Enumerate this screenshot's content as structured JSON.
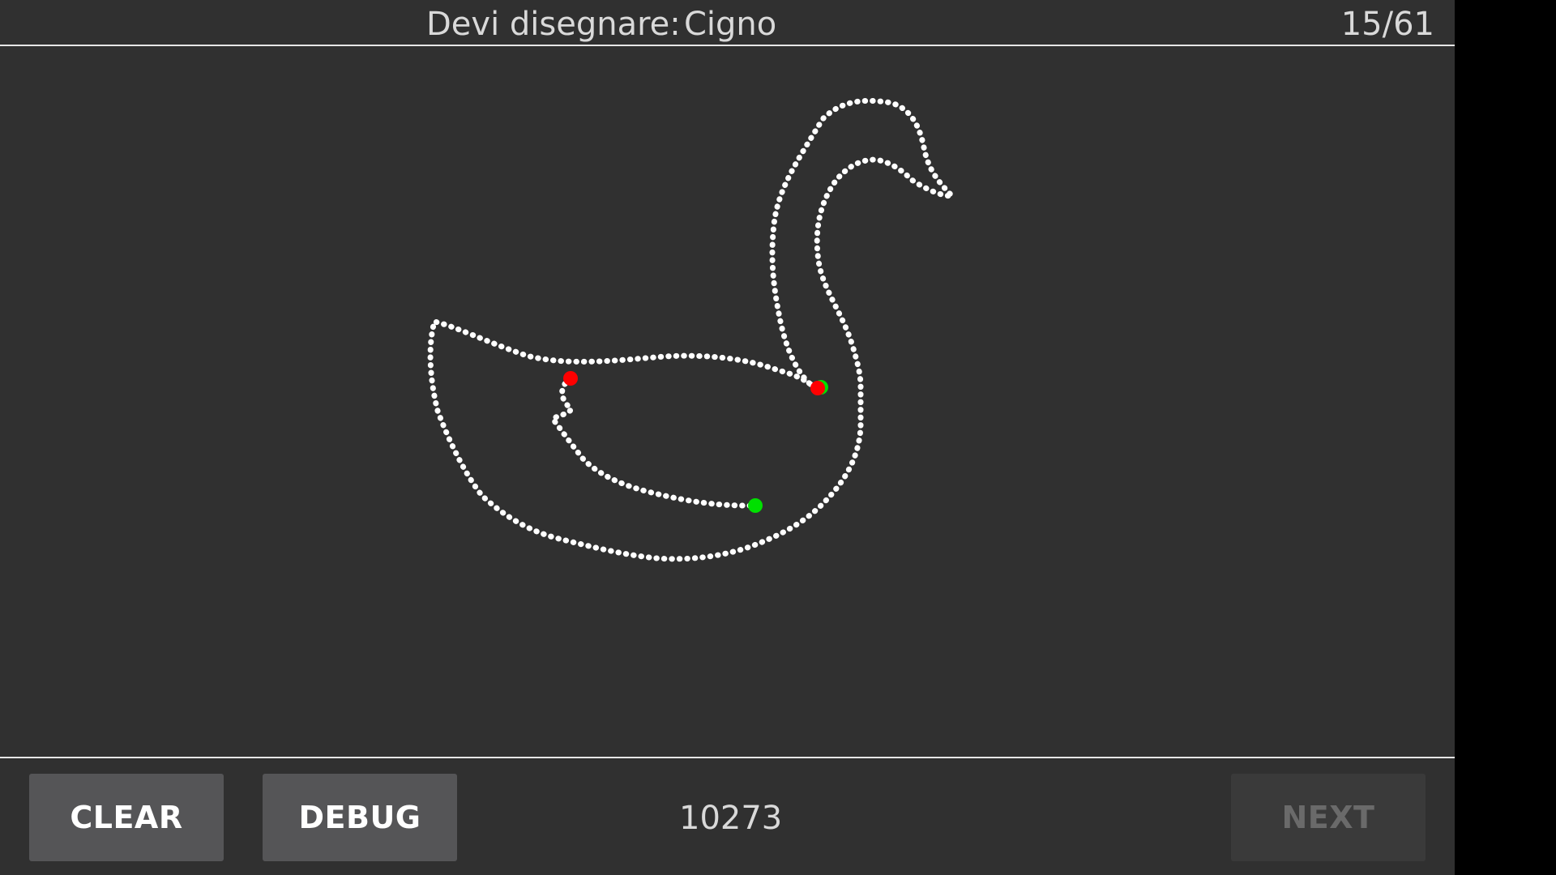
{
  "header": {
    "prompt_label": "Devi disegnare:",
    "target_word": "Cigno",
    "progress": "15/61"
  },
  "footer": {
    "clear_label": "CLEAR",
    "debug_label": "DEBUG",
    "score": "10273",
    "next_label": "NEXT"
  },
  "colors": {
    "background": "#303030",
    "stroke": "#ffffff",
    "stroke_start": "#00e000",
    "stroke_end": "#ff0000",
    "button": "#555557",
    "button_disabled": "#3a3a3a"
  },
  "drawing": {
    "subject": "swan",
    "stroke_count": 2
  }
}
